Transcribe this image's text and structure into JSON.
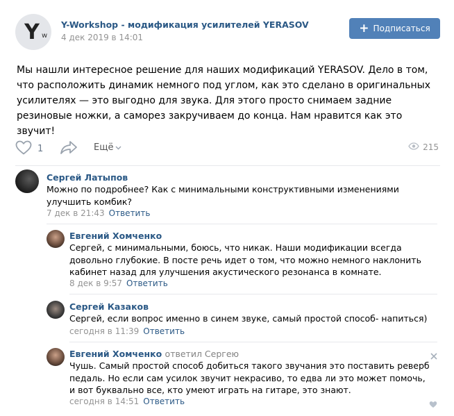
{
  "post": {
    "group_name": "Y-Workshop - модификация усилителей YERASOV",
    "date": "4 дек 2019 в 14:01",
    "avatar_letter": "Y",
    "avatar_small": "w",
    "subscribe_label": "Подписаться",
    "text": "Мы нашли интересное решение для наших модификаций YERASOV. Дело в том, что расположить динамик немного под углом, как это сделано в оригинальных усилителях — это выгодно для звука. Для этого просто снимаем задние резиновые ножки, а саморез закручиваем до конца. Нам нравится как это звучит!",
    "likes": "1",
    "more_label": "Ещё",
    "views": "215"
  },
  "comments": [
    {
      "author": "Сергей Латыпов",
      "text": "Можно по подробнее? Как с минимальными конструктивными изменениями улучшить комбик?",
      "date": "7 дек в 21:43",
      "reply": "Ответить"
    },
    {
      "author": "Евгений Хомченко",
      "text": "Сергей, с минимальными, боюсь, что никак. Наши модификации всегда довольно глубокие. В посте речь идет о том, что можно немного наклонить кабинет назад для улучшения акустического резонанса в комнате.",
      "date": "8 дек в 9:57",
      "reply": "Ответить"
    },
    {
      "author": "Сергей Казаков",
      "text": "Сергей, если вопрос именно в синем звуке, самый простой способ- напиться)",
      "date": "сегодня в 11:39",
      "reply": "Ответить"
    },
    {
      "author": "Евгений Хомченко",
      "replied": "ответил Сергею",
      "text": "Чушь. Самый простой способ добиться такого звучания это поставить реверб педаль. Но если сам усилок звучит некрасиво, то едва ли это может помочь, и вот буквально все, кто умеют играть на гитаре, это знают.",
      "date": "сегодня в 14:51",
      "reply": "Ответить"
    }
  ],
  "colors": {
    "link": "#2a5885",
    "button": "#5181b8",
    "muted": "#939393",
    "divider": "#e7e8ec"
  },
  "icons": [
    "heart-icon",
    "share-arrow-icon",
    "chevron-down-icon",
    "eye-icon",
    "close-icon",
    "like-heart-small-icon"
  ]
}
